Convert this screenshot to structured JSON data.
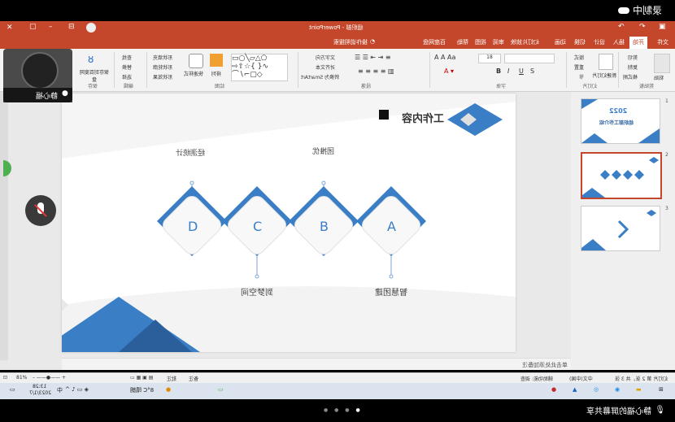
{
  "recording": {
    "label": "录制中"
  },
  "window": {
    "title": "组织部 - PowerPoint"
  },
  "ribbon_tabs": [
    "文件",
    "开始",
    "插入",
    "设计",
    "切换",
    "动画",
    "幻灯片放映",
    "审阅",
    "视图",
    "帮助",
    "百度网盘",
    "操作说明搜索"
  ],
  "ribbon": {
    "clipboard": {
      "paste": "粘贴",
      "cut": "剪切",
      "copy": "复制",
      "format_painter": "格式刷",
      "group": "剪贴板"
    },
    "slides": {
      "new_slide": "新建幻灯片",
      "layout": "版式",
      "reset": "重置",
      "section": "节",
      "group": "幻灯片"
    },
    "font": {
      "size": "18",
      "group": "字体"
    },
    "paragraph": {
      "text_direction": "文字方向",
      "align_text": "对齐文本",
      "smartart": "转换为 SmartArt",
      "group": "段落"
    },
    "drawing": {
      "arrange": "排列",
      "quick_styles": "快速样式",
      "shape_fill": "形状填充",
      "shape_outline": "形状轮廓",
      "shape_effects": "形状效果",
      "group": "绘图"
    },
    "editing": {
      "find": "查找",
      "replace": "替换",
      "select": "选择",
      "group": "编辑"
    },
    "save": {
      "label": "保存到百度网盘",
      "group": "保存"
    }
  },
  "camera": {
    "name": "静心福"
  },
  "slide": {
    "title": "工作内容",
    "diamonds": [
      "A",
      "B",
      "C",
      "D"
    ],
    "labels_top": [
      "团推优",
      "经测统计"
    ],
    "labels_bottom": [
      "智慧团建",
      "到梦空间"
    ]
  },
  "thumbnails": [
    {
      "num": "1",
      "title": "组织部工作介绍",
      "year": "2022"
    },
    {
      "num": "2"
    },
    {
      "num": "3"
    }
  ],
  "notes": {
    "placeholder": "单击此处添加备注"
  },
  "status": {
    "slide_info": "幻灯片 第 2 张，共 3 张",
    "language": "中文(中国)",
    "accessibility": "辅助功能: 调查",
    "notes_btn": "备注",
    "comments_btn": "批注",
    "zoom": "81%"
  },
  "taskbar": {
    "weather": "8°C 晴朗",
    "ime": "中",
    "time": "13:28",
    "date": "2023/1/7"
  },
  "share_banner": {
    "text": "静心福的屏幕共享"
  }
}
